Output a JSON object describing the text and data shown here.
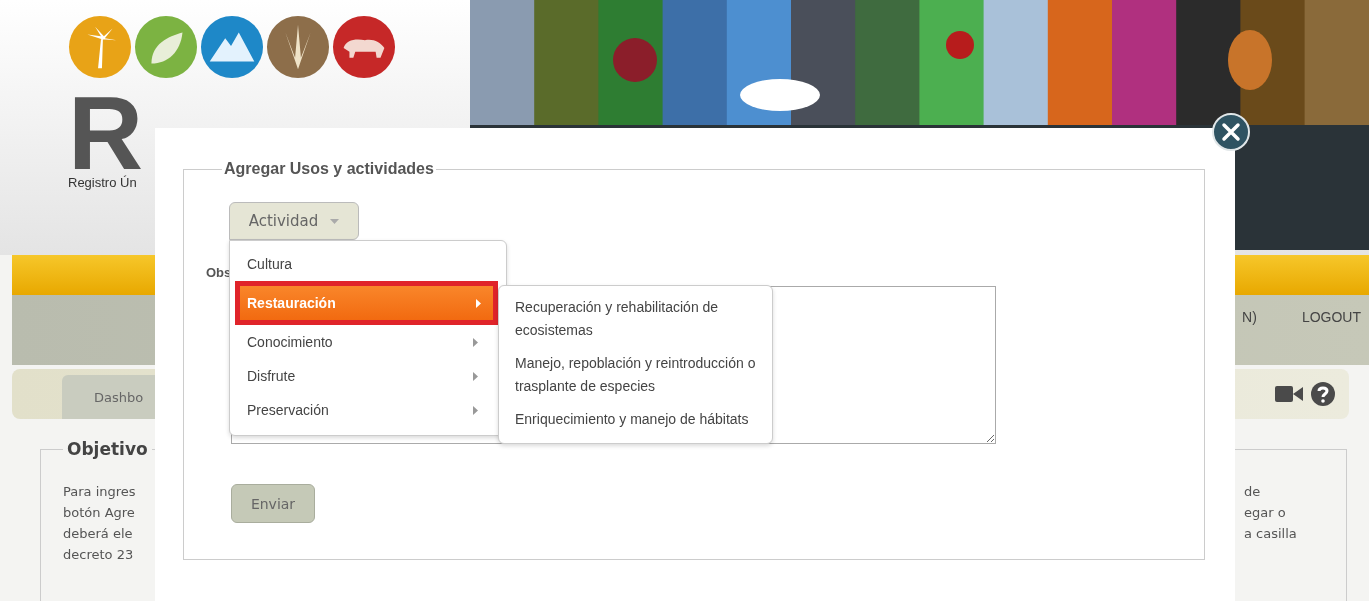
{
  "header": {
    "logo_text": "R",
    "logo_subtitle": "Registro Ún"
  },
  "nav": {
    "items": [
      {
        "label": "N)"
      },
      {
        "label": "LOGOUT"
      }
    ]
  },
  "tab": {
    "label": "Dashbo"
  },
  "objective": {
    "title": "Objetivo",
    "left_lines": [
      "Para ingres",
      "botón Agre",
      "deberá ele",
      "decreto 23"
    ],
    "right_lines": [
      "de",
      "egar o",
      "a casilla"
    ]
  },
  "modal": {
    "legend": "Agregar Usos y actividades",
    "dropdown": {
      "label": "Actividad",
      "expanded": true
    },
    "field_label": "Obs",
    "menu": [
      {
        "label": "Cultura",
        "has_submenu": false,
        "selected": false
      },
      {
        "label": "Restauración",
        "has_submenu": true,
        "selected": true
      },
      {
        "label": "Conocimiento",
        "has_submenu": true,
        "selected": false
      },
      {
        "label": "Disfrute",
        "has_submenu": true,
        "selected": false
      },
      {
        "label": "Preservación",
        "has_submenu": true,
        "selected": false
      }
    ],
    "submenu": [
      {
        "label": "Recuperación y rehabilitación de ecosistemas"
      },
      {
        "label": "Manejo, repoblación y reintroducción o trasplante de especies"
      },
      {
        "label": "Enriquecimiento y manejo de hábitats"
      }
    ],
    "submit": "Enviar"
  }
}
